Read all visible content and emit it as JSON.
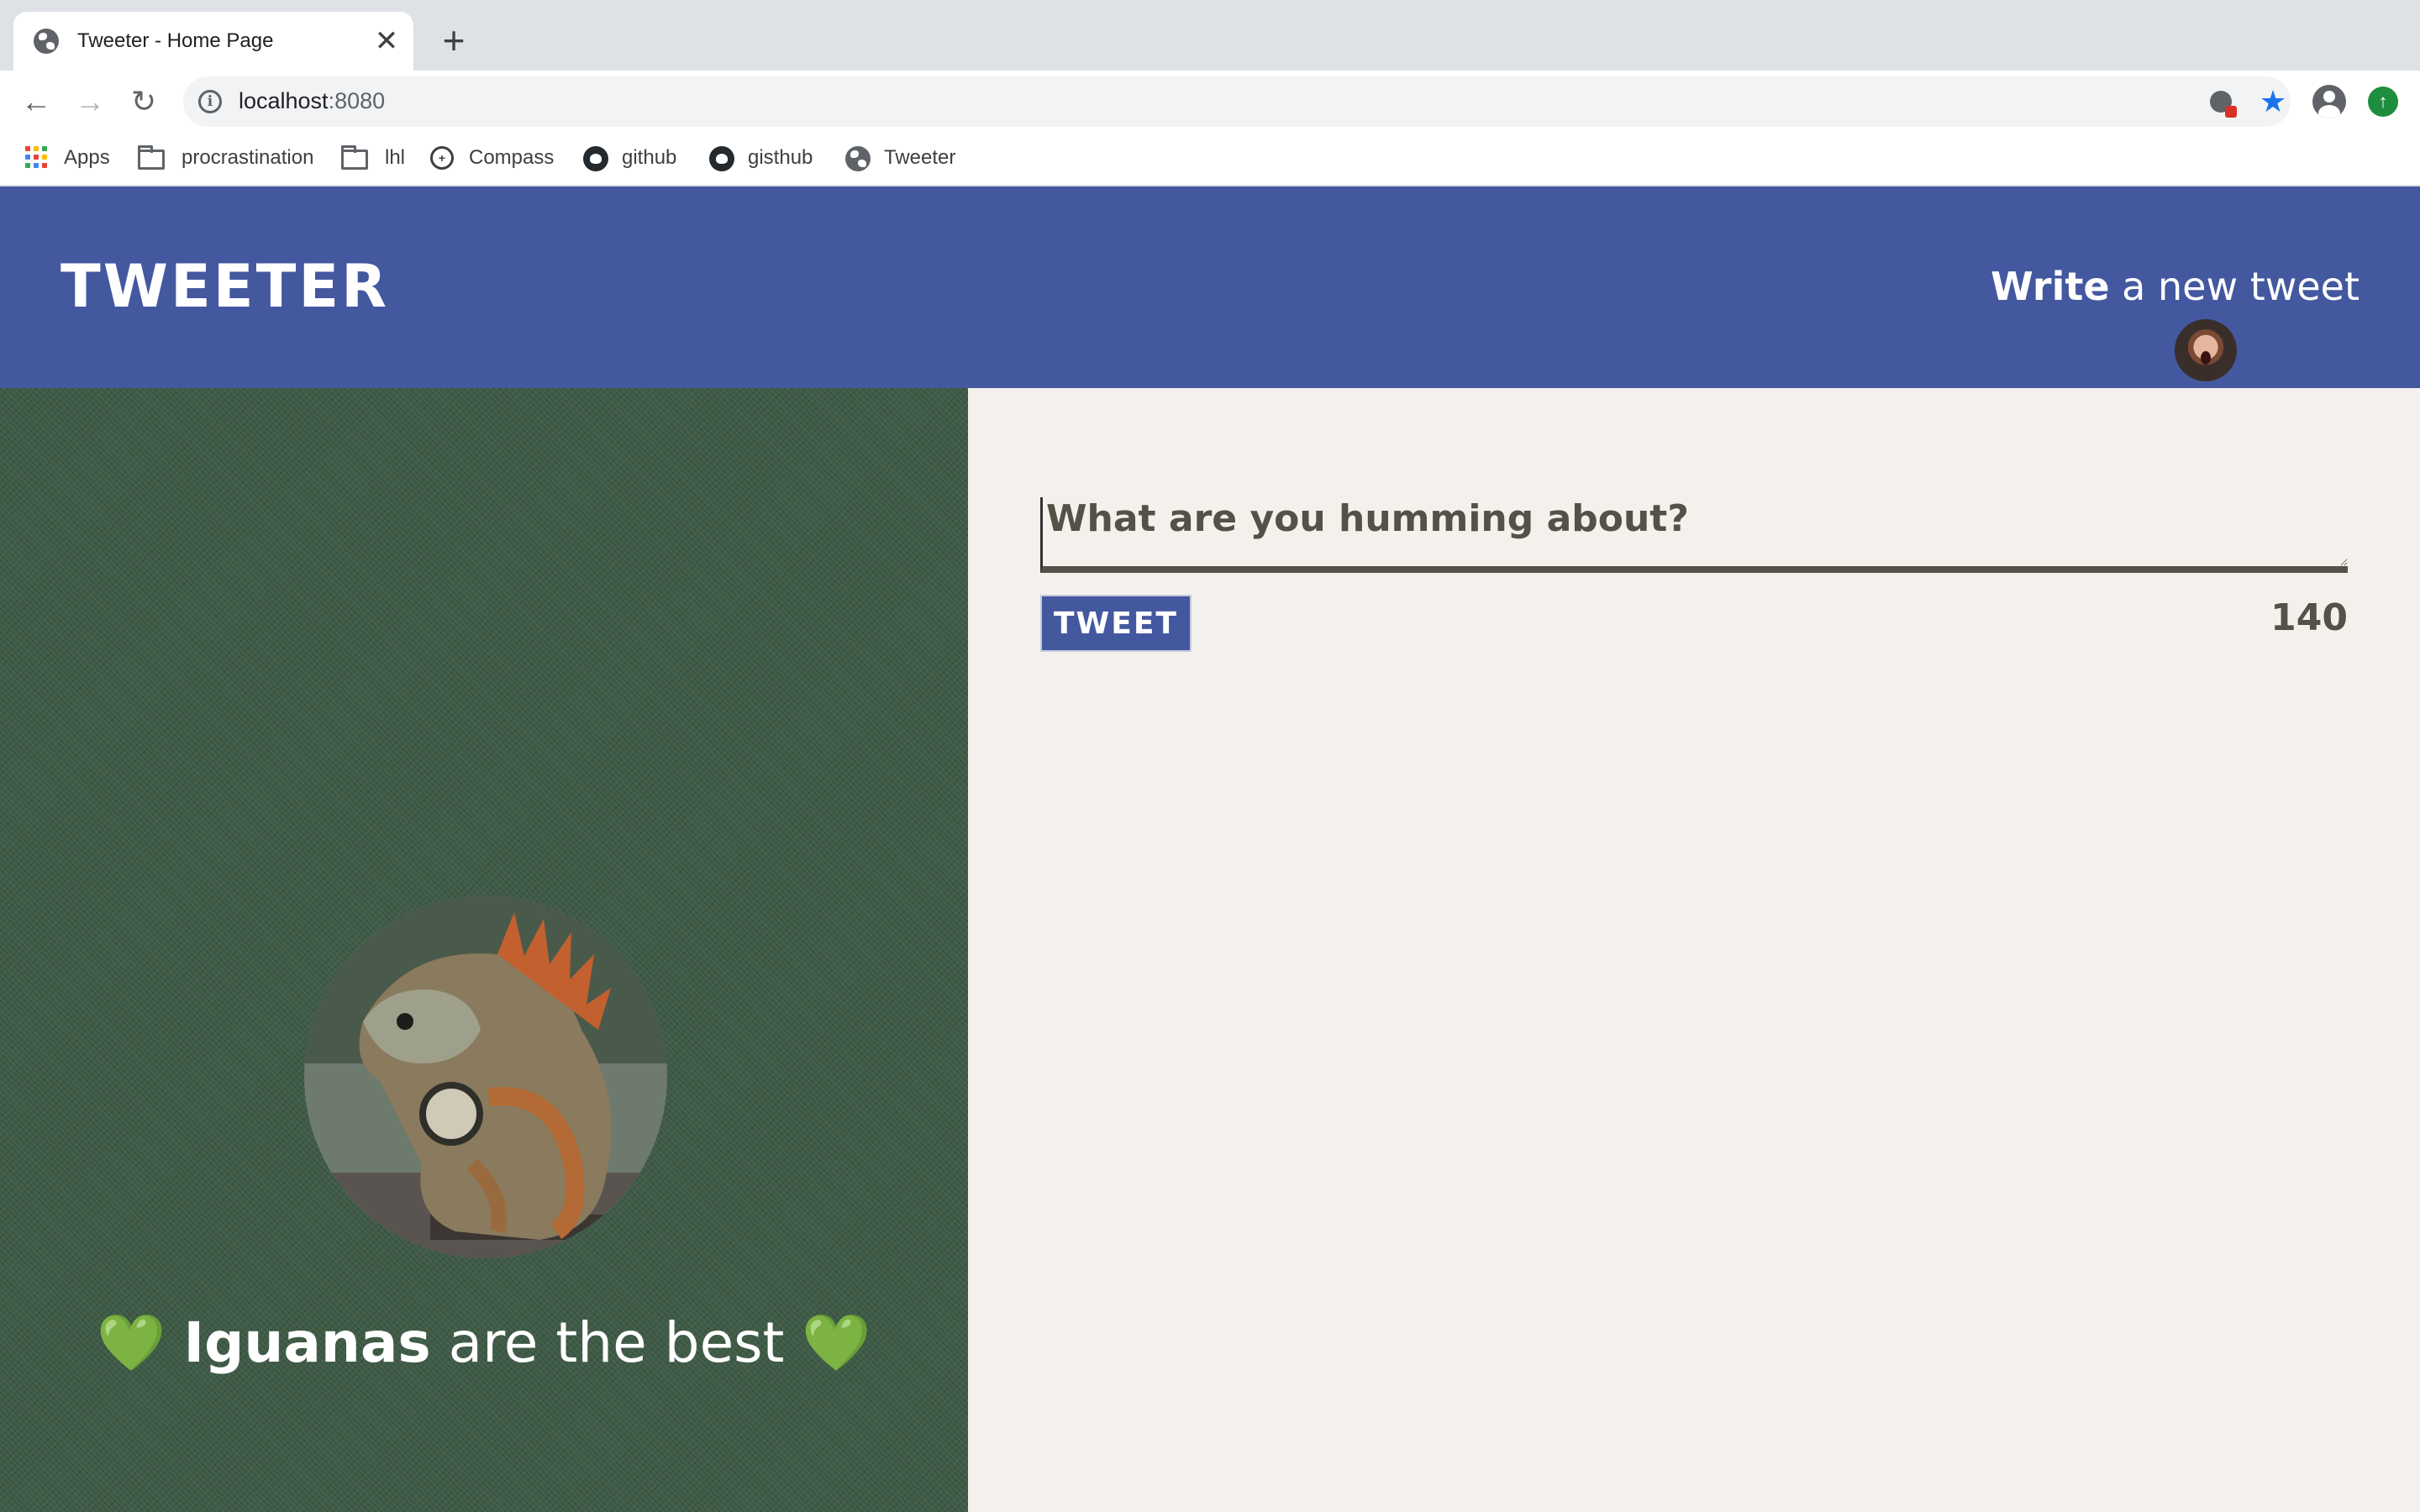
{
  "browser": {
    "tab": {
      "title": "Tweeter - Home Page",
      "favicon": "globe-icon",
      "close": "✕"
    },
    "new_tab": "+",
    "address": {
      "host": "localhost",
      "port": ":8080"
    },
    "bookmarks": [
      {
        "label": "Apps",
        "icon": "apps-grid-icon"
      },
      {
        "label": "procrastination",
        "icon": "folder-icon"
      },
      {
        "label": "lhl",
        "icon": "folder-icon"
      },
      {
        "label": "Compass",
        "icon": "compass-icon"
      },
      {
        "label": "github",
        "icon": "github-icon"
      },
      {
        "label": "gisthub",
        "icon": "github-icon"
      },
      {
        "label": "Tweeter",
        "icon": "globe-icon"
      }
    ]
  },
  "navbar": {
    "logo": "Tweeter",
    "compose_bold": "Write",
    "compose_rest": " a new tweet",
    "color": "#4458a0"
  },
  "profile": {
    "heart": "💚",
    "name_bold": "Iguanas",
    "name_rest": " are the best ",
    "background": "#3d5a45"
  },
  "compose": {
    "placeholder": "What are you humming about?",
    "value": "",
    "button_label": "Tweet",
    "counter": "140"
  }
}
